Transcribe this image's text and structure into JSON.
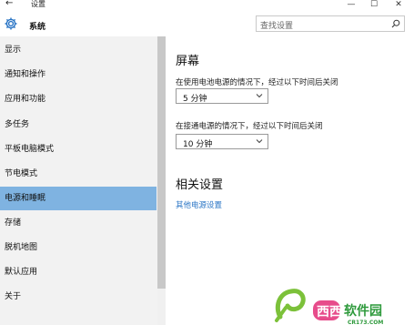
{
  "window": {
    "title": "设置",
    "back": "←",
    "minimize": "—",
    "maximize": "☐",
    "close": "✕"
  },
  "header": {
    "section": "系统",
    "search_placeholder": "查找设置",
    "section_icon": "gear-icon",
    "search_icon": "search-icon"
  },
  "sidebar": {
    "items": [
      {
        "label": "显示"
      },
      {
        "label": "通知和操作"
      },
      {
        "label": "应用和功能"
      },
      {
        "label": "多任务"
      },
      {
        "label": "平板电脑模式"
      },
      {
        "label": "节电模式"
      },
      {
        "label": "电源和睡眠",
        "active": true
      },
      {
        "label": "存储"
      },
      {
        "label": "脱机地图"
      },
      {
        "label": "默认应用"
      },
      {
        "label": "关于"
      }
    ],
    "active_color": "#7fb3e1"
  },
  "content": {
    "screen_heading": "屏幕",
    "battery_label": "在使用电池电源的情况下，经过以下时间后关闭",
    "battery_value": "5 分钟",
    "plugged_label": "在接通电源的情况下，经过以下时间后关闭",
    "plugged_value": "10 分钟",
    "related_heading": "相关设置",
    "related_link": "其他电源设置",
    "link_color": "#2a75c5"
  },
  "watermark": {
    "brand": "西西软件园",
    "domain": "CR173.COM"
  }
}
